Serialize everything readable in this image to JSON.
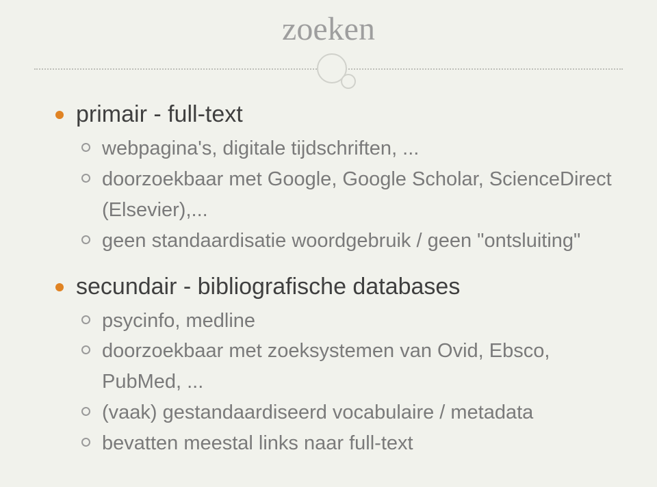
{
  "title": "zoeken",
  "bullets": [
    {
      "text": "primair - full-text",
      "sub": [
        "webpagina's, digitale tijdschriften, ...",
        "doorzoekbaar met Google, Google Scholar, ScienceDirect (Elsevier),...",
        "geen standaardisatie woordgebruik / geen \"ontsluiting\""
      ]
    },
    {
      "text": "secundair - bibliografische databases",
      "sub": [
        "psycinfo, medline",
        "doorzoekbaar met zoeksystemen van Ovid, Ebsco, PubMed, ...",
        "(vaak) gestandaardiseerd vocabulaire / metadata",
        "bevatten meestal links naar full-text"
      ]
    }
  ]
}
